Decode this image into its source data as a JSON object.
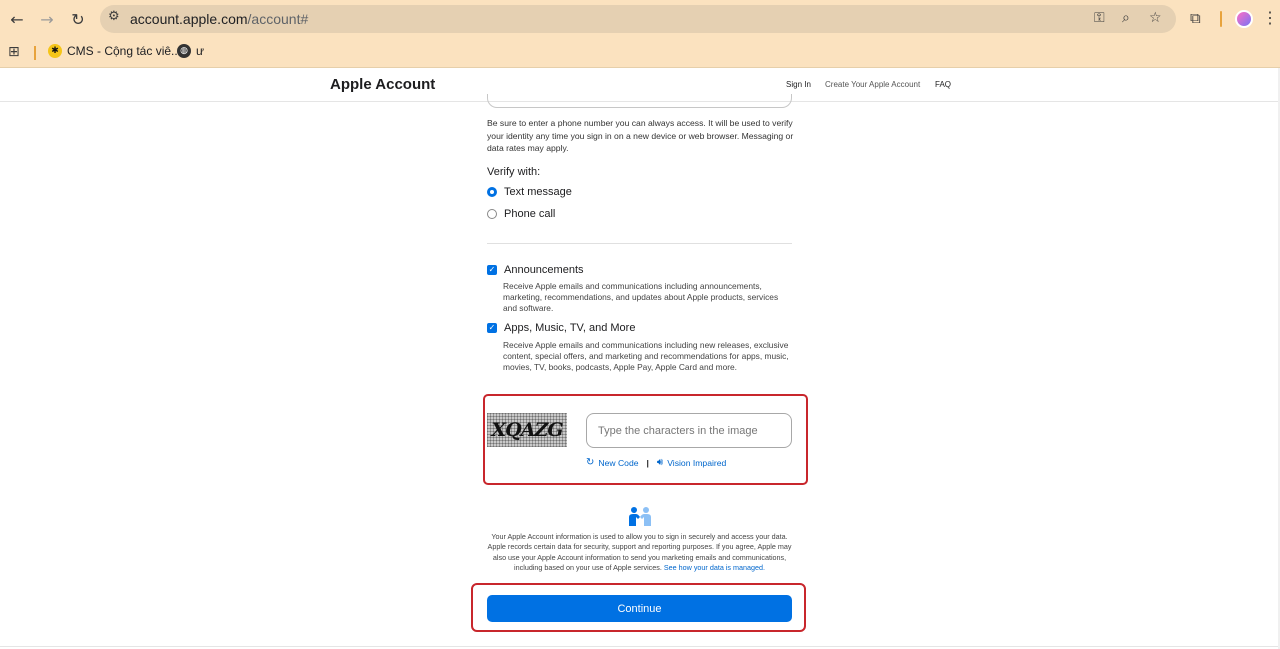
{
  "browser": {
    "url_host": "account.apple.com",
    "url_path": "/account#",
    "bookmarks": [
      {
        "label": "CMS - Cộng tác viê..."
      },
      {
        "label": "ư"
      }
    ]
  },
  "header": {
    "brand": "Apple Account",
    "links": [
      "Sign In",
      "Create Your Apple Account",
      "FAQ"
    ]
  },
  "form": {
    "phone_help": "Be sure to enter a phone number you can always access. It will be used to verify your identity any time you sign in on a new device or web browser. Messaging or data rates may apply.",
    "verify_label": "Verify with:",
    "verify_options": [
      {
        "label": "Text message",
        "selected": true
      },
      {
        "label": "Phone call",
        "selected": false
      }
    ],
    "subscriptions": [
      {
        "label": "Announcements",
        "checked": true,
        "description": "Receive Apple emails and communications including announcements, marketing, recommendations, and updates about Apple products, services and software."
      },
      {
        "label": "Apps, Music, TV, and More",
        "checked": true,
        "description": "Receive Apple emails and communications including new releases, exclusive content, special offers, and marketing and recommendations for apps, music, movies, TV, books, podcasts, Apple Pay, Apple Card and more."
      }
    ],
    "captcha": {
      "image_text": "XQAZG",
      "placeholder": "Type the characters in the image",
      "value": "",
      "new_code": "New Code",
      "vision_impaired": "Vision Impaired"
    },
    "privacy_text": "Your Apple Account information is used to allow you to sign in securely and access your data. Apple records certain data for security, support and reporting purposes. If you agree, Apple may also use your Apple Account information to send you marketing emails and communications, including based on your use of Apple services.",
    "privacy_link": "See how your data is managed.",
    "continue_label": "Continue"
  },
  "colors": {
    "accent": "#0071e3",
    "highlight": "#c8262c",
    "chrome": "#fbe2bf"
  }
}
